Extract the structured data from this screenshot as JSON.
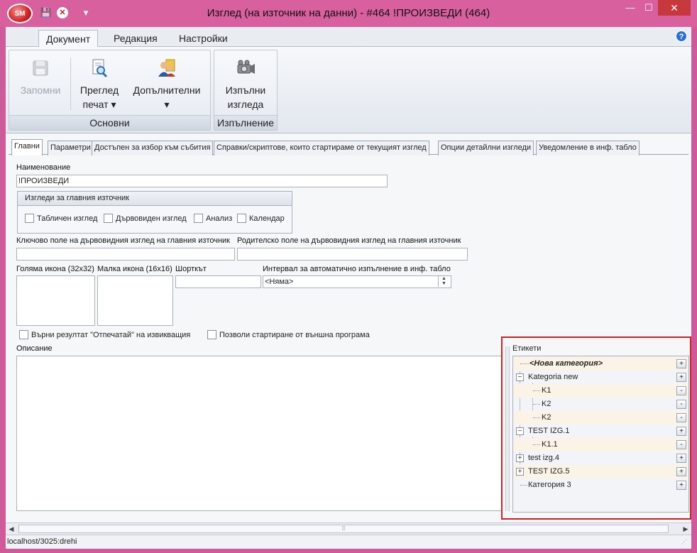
{
  "window": {
    "logo": "SM",
    "title": "Изглед (на източник на данни) - #464 !ПРОИЗВЕДИ (464)",
    "minimize": "—",
    "maximize": "☐",
    "close": "✕"
  },
  "ribbon": {
    "tabs": [
      "Документ",
      "Редакция",
      "Настройки"
    ],
    "groups": {
      "basic": {
        "label": "Основни",
        "save": {
          "line1": "Запомни"
        },
        "preview": {
          "line1": "Преглед",
          "line2": "печат ▾"
        },
        "additional": {
          "line1": "Допълнителни",
          "line2": "▾"
        }
      },
      "exec": {
        "label": "Изпълнение",
        "run": {
          "line1": "Изпълни",
          "line2": "изгледа"
        }
      }
    }
  },
  "tabs": [
    "Главни",
    "Параметри",
    "Достъпен за избор към събития",
    "Справки/скриптове, които стартираме от текущият изглед",
    "Опции детайлни изгледи",
    "Уведомление в инф. табло"
  ],
  "form": {
    "name_label": "Наименование",
    "name_value": "!ПРОИЗВЕДИ",
    "views_group_title": "Изгледи за главния източник",
    "views_checkboxes": [
      "Табличен изглед",
      "Дървовиден изглед",
      "Анализ",
      "Календар"
    ],
    "key_field_label": "Ключово поле на дървовидния изглед на главния източник",
    "parent_field_label": "Родителско поле на дървовидния изглед на главния източник",
    "big_icon_label": "Голяма икона (32x32)",
    "small_icon_label": "Малка икона (16x16)",
    "shortcut_label": "Шорткът",
    "interval_label": "Интервал за автоматично изпълнение в инф. табло",
    "interval_value": "<Няма>",
    "return_result_label": "Върни резултат \"Отпечатай\" на извикващия",
    "allow_external_label": "Позволи стартиране от външна програма",
    "description_label": "Описание"
  },
  "tags": {
    "label": "Етикети",
    "items": [
      {
        "text": "<Нова категория>",
        "button": "+"
      },
      {
        "text": "Kategoria new",
        "button": "+",
        "expander": "−"
      },
      {
        "text": "K1",
        "button": "-"
      },
      {
        "text": "K2",
        "button": "-"
      },
      {
        "text": "K2",
        "button": "-"
      },
      {
        "text": "TEST IZG.1",
        "button": "+",
        "expander": "−"
      },
      {
        "text": "K1.1",
        "button": "-"
      },
      {
        "text": "test izg.4",
        "button": "+",
        "expander": "+"
      },
      {
        "text": "TEST IZG.5",
        "button": "+",
        "expander": "+"
      },
      {
        "text": "Категория 3",
        "button": "+"
      }
    ]
  },
  "scroll": {
    "left": "◀",
    "right": "▶",
    "grip": "⁞⁞"
  },
  "status": {
    "url": "localhost/3025:drehi"
  }
}
